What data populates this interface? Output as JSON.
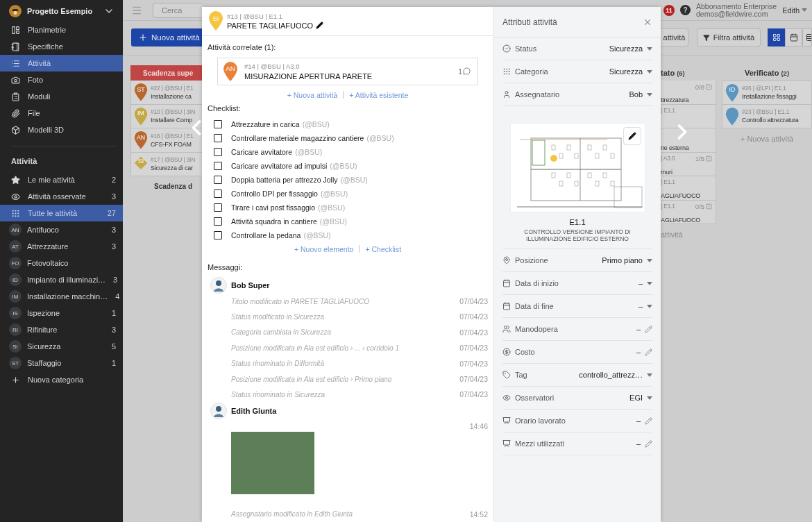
{
  "sidebar": {
    "project": "Progetto Esempio",
    "nav": [
      {
        "label": "Planimetrie",
        "selected": false
      },
      {
        "label": "Specifiche",
        "selected": false
      },
      {
        "label": "Attività",
        "selected": true
      },
      {
        "label": "Foto",
        "selected": false
      },
      {
        "label": "Moduli",
        "selected": false
      },
      {
        "label": "File",
        "selected": false
      },
      {
        "label": "Modelli 3D",
        "selected": false
      }
    ],
    "section_title": "Attività",
    "filters": [
      {
        "kind": "icon",
        "label": "Le mie attività",
        "count": "2",
        "selected": false
      },
      {
        "kind": "icon",
        "label": "Attività osservate",
        "count": "3",
        "selected": false
      },
      {
        "kind": "icon",
        "label": "Tutte le attività",
        "count": "27",
        "selected": true
      },
      {
        "kind": "category",
        "code": "AN",
        "label": "Antifuoco",
        "count": "3",
        "selected": false
      },
      {
        "kind": "category",
        "code": "AT",
        "label": "Attrezzature",
        "count": "3",
        "selected": false
      },
      {
        "kind": "category",
        "code": "FO",
        "label": "Fotovoltaico",
        "selected": false
      },
      {
        "kind": "category",
        "code": "ID",
        "label": "Impianto di illuminazi…",
        "count": "3",
        "selected": false
      },
      {
        "kind": "category",
        "code": "IM",
        "label": "Installazione macchin…",
        "count": "4",
        "selected": false
      },
      {
        "kind": "category",
        "code": "IS",
        "label": "Ispezione",
        "count": "1",
        "selected": false
      },
      {
        "kind": "category",
        "code": "RI",
        "label": "Rifiniture",
        "count": "3",
        "selected": false
      },
      {
        "kind": "category",
        "code": "SI",
        "label": "Sicurezza",
        "count": "5",
        "selected": false
      },
      {
        "kind": "category",
        "code": "ST",
        "label": "Staffaggio",
        "count": "1",
        "selected": false
      }
    ],
    "add_category": "Nuova categoria"
  },
  "topbar": {
    "search_placeholder": "Cerca",
    "notifications": "11",
    "help": "?",
    "plan": "Abbonamento Enterprise",
    "email": "demos@fieldwire.com",
    "user": "Edith"
  },
  "toolbar": {
    "new_task": "Nuova attività",
    "partial_button": "attività",
    "filter": "Filtra attività",
    "views": [
      {
        "kind": "grid",
        "selected": true
      },
      {
        "kind": "calendar",
        "selected": false
      },
      {
        "kind": "list",
        "selected": false
      }
    ]
  },
  "board_left": {
    "header": "Scadenza supe",
    "cards": [
      {
        "kind": "pin",
        "code": "ST",
        "color": "#b8672f",
        "meta": "#22 | @BSU | E1",
        "title": "Installazione ca"
      },
      {
        "kind": "pin",
        "code": "IM",
        "color": "#c4a845",
        "meta": "#10 | @BSU | 3IN",
        "title": "Installare Comp"
      },
      {
        "kind": "pin",
        "code": "AN",
        "color": "#b8672f",
        "meta": "#16 | @BSU | E1",
        "title": "CFS-FX FOAM"
      },
      {
        "kind": "diamond",
        "code": "SI",
        "color": "#c4a845",
        "meta": "#17 | @BSU | 3IN",
        "title": "Sicurezza di car"
      }
    ],
    "footer": "Scadenza d"
  },
  "board_right": {
    "column_a": {
      "header": "tato",
      "count": "(6)",
      "cards": [
        {
          "count": "0/8",
          "title": "ttrezzatura"
        },
        {
          "meta": "| E1.1"
        },
        {
          "title": "ne esterna"
        },
        {
          "meta": "| A3.0",
          "count": "1/5",
          "title": "muri"
        },
        {
          "meta": "| E1.1",
          "title": "AGLIAFUOCO"
        },
        {
          "meta": "| E1.1",
          "count": "0/5",
          "title": "AGLIAFUOCO"
        }
      ],
      "footer": "attività"
    },
    "column_b": {
      "header": "Verificato",
      "count": "(2)",
      "cards": [
        {
          "kind": "pin",
          "code": "ID",
          "color": "#5b95c0",
          "meta": "#26 | @LPI | E1.1",
          "title": "Installazione fissaggi"
        },
        {
          "kind": "pin",
          "color": "#5b95c0",
          "meta": "#23 | @BSU | E1.1",
          "title": "Controllo attrezzatura"
        }
      ],
      "footer": "+ Nuova attività"
    }
  },
  "task": {
    "code": "SI",
    "color": "#f5c542",
    "meta": "#13 | @BSU | E1.1",
    "title": "PARETE TAGLIAFUOCO",
    "related_title": "Attività correlate (1):",
    "related": [
      {
        "code": "AN",
        "color": "#e8823a",
        "meta": "#14 | @BSU | A3.0",
        "title": "MISURAZIONE APERTURA PARETE",
        "comments": "1"
      }
    ],
    "related_links": [
      "+ Nuova attività",
      "+ Attività esistente"
    ],
    "checklist_title": "Checklist:",
    "checklist": [
      {
        "text": "Attrezzature in carica",
        "assignee": "(@BSU)",
        "checked": false
      },
      {
        "text": "Controllare materiale magazzino cantiere",
        "assignee": "(@BSU)",
        "checked": false
      },
      {
        "text": "Caricare avvitatore",
        "assignee": "(@BSU)",
        "checked": false
      },
      {
        "text": "Caricare avvitatore ad impulsi",
        "assignee": "(@BSU)",
        "checked": false
      },
      {
        "text": "Doppia batteria per attrezzo Jolly",
        "assignee": "(@BSU)",
        "checked": false
      },
      {
        "text": "Controllo DPI per fissaggio",
        "assignee": "(@BSU)",
        "checked": false
      },
      {
        "text": "Tirare i cavi post fissaggio",
        "assignee": "(@BSU)",
        "checked": false
      },
      {
        "text": "Attività squadra in cantiere",
        "assignee": "(@BSU)",
        "checked": false
      },
      {
        "text": "Controllare la pedana",
        "assignee": "(@BSU)",
        "checked": false
      }
    ],
    "checklist_links": [
      "+ Nuovo elemento",
      "+ Checklist"
    ],
    "messages_title": "Messaggi:",
    "messages": [
      {
        "author": "Bob Super",
        "entries": [
          {
            "kind": "change",
            "text": "Titolo modificato in PARETE TAGLIAFUOCO",
            "time": "07/04/23"
          },
          {
            "kind": "change",
            "text": "Status modificato in Sicurezza",
            "time": "07/04/23"
          },
          {
            "kind": "change",
            "text": "Categoria cambiata in Sicurezza",
            "time": "07/04/23"
          },
          {
            "kind": "change",
            "text": "Posizione modificata in Ala est edificio › ... › corridoio 1",
            "time": "07/04/23"
          },
          {
            "kind": "change",
            "text": "Status rinominato in Difformità",
            "time": "07/04/23"
          },
          {
            "kind": "change",
            "text": "Posizione modificata in Ala est edificio › Primo piano",
            "time": "07/04/23"
          },
          {
            "kind": "change",
            "text": "Status rinominato in Sicurezza",
            "time": "07/04/23"
          }
        ]
      },
      {
        "author": "Edith Giunta",
        "entries": [
          {
            "kind": "photo",
            "time": "14:46"
          },
          {
            "kind": "change",
            "text": "Assegnatario modificato in Edith Giunta",
            "time": "14:52"
          }
        ]
      }
    ]
  },
  "attributes": {
    "title": "Attributi attività",
    "items": [
      {
        "kind": "select",
        "label": "Status",
        "value": "Sicurezza"
      },
      {
        "kind": "select",
        "label": "Categoria",
        "value": "Sicurezza"
      },
      {
        "kind": "select",
        "label": "Assegnatario",
        "value": "Bob"
      },
      {
        "kind": "plan",
        "sheet": "E1.1",
        "description": "CONTROLLO VERSIONE IMPIANTO DI ILLUMINAZIONE EDIFICIO ESTERNO"
      },
      {
        "kind": "select",
        "label": "Posizione",
        "value": "Primo piano"
      },
      {
        "kind": "select",
        "label": "Data di inizio",
        "value": "–"
      },
      {
        "kind": "select",
        "label": "Data di fine",
        "value": "–"
      },
      {
        "kind": "edit",
        "label": "Manodopera",
        "value": "–"
      },
      {
        "kind": "edit",
        "label": "Costo",
        "value": "–"
      },
      {
        "kind": "select",
        "label": "Tag",
        "value": "controllo_attrezz…"
      },
      {
        "kind": "select",
        "label": "Osservatori",
        "value": "EGI"
      },
      {
        "kind": "edit",
        "label": "Orario lavorato",
        "value": "–"
      },
      {
        "kind": "edit",
        "label": "Mezzi utilizzati",
        "value": "–"
      }
    ]
  }
}
